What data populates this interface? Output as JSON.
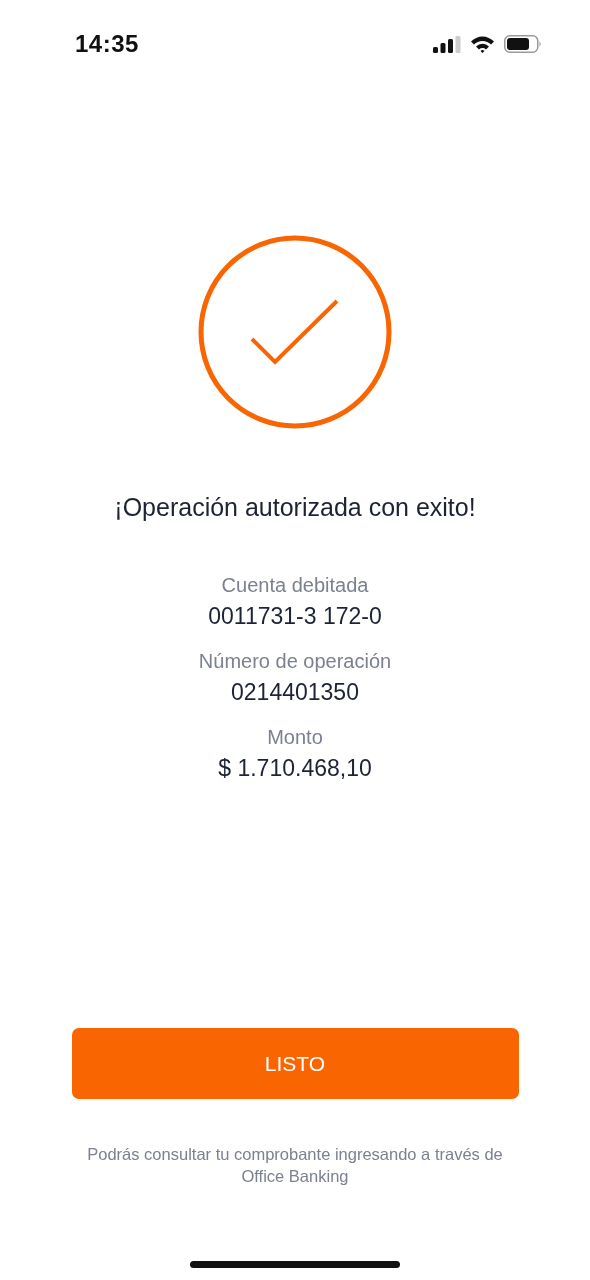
{
  "status_bar": {
    "time": "14:35"
  },
  "title": "¡Operación autorizada con exito!",
  "details": [
    {
      "label": "Cuenta debitada",
      "value": "0011731-3 172-0"
    },
    {
      "label": "Número de operación",
      "value": "0214401350"
    },
    {
      "label": "Monto",
      "value": "$ 1.710.468,10"
    }
  ],
  "button": {
    "label": "LISTO"
  },
  "footer": "Podrás consultar tu comprobante ingresando a través de Office Banking"
}
